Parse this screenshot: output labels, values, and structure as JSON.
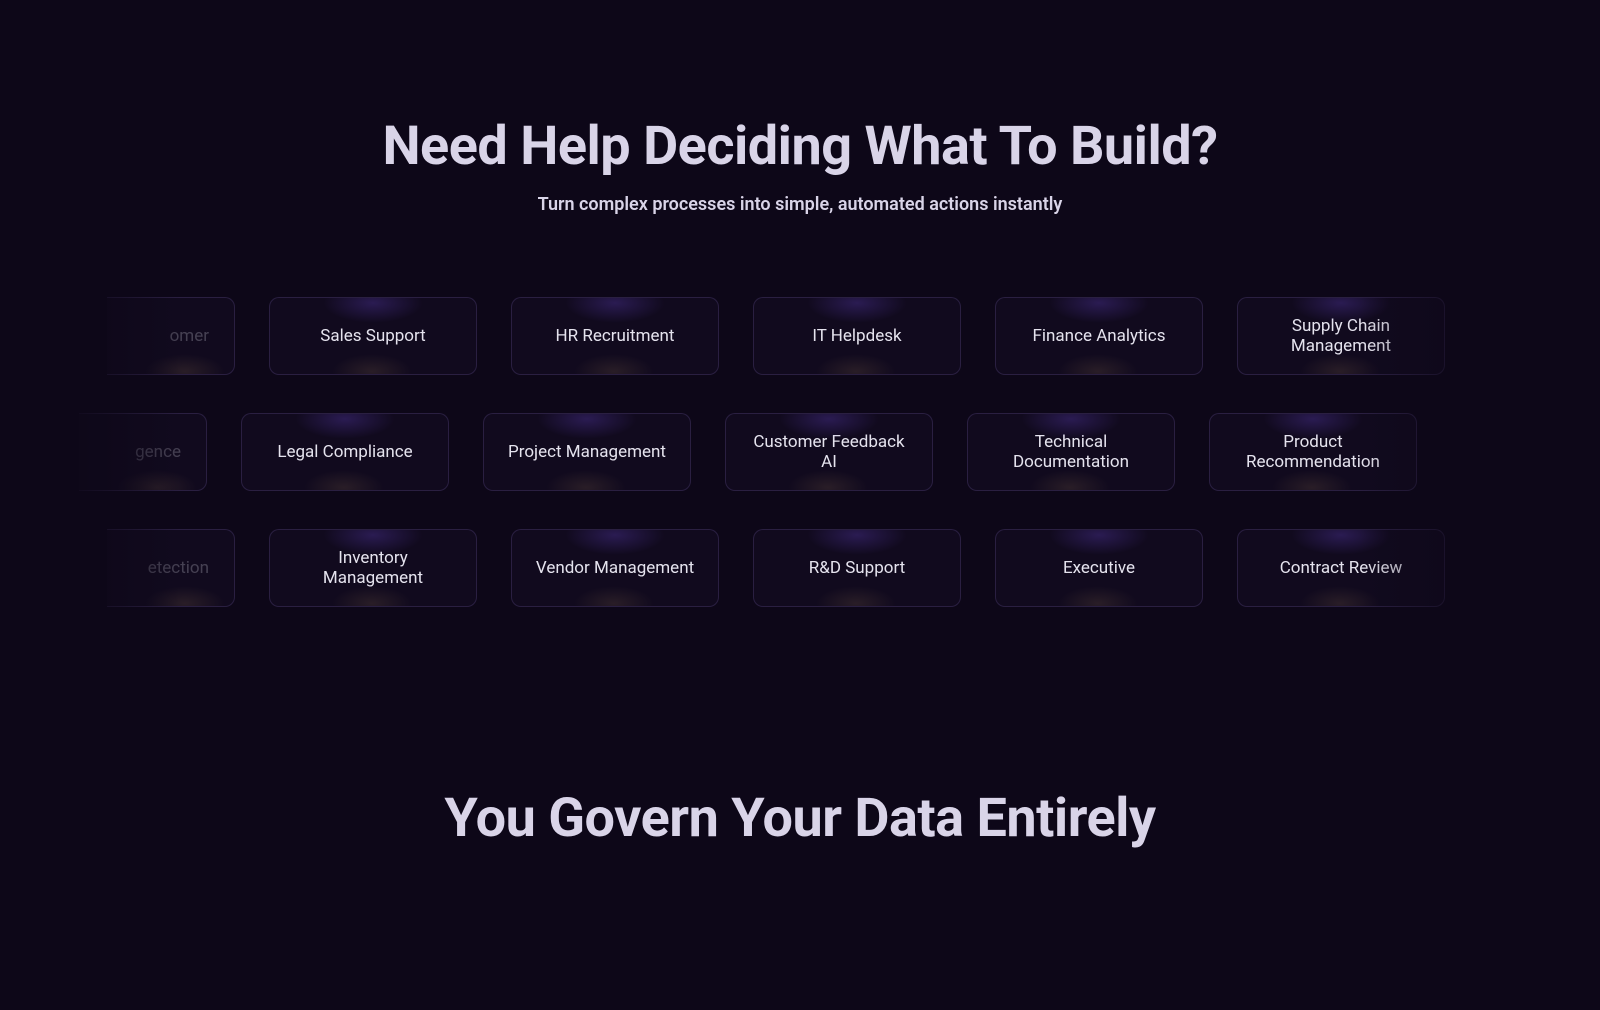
{
  "hero": {
    "title": "Need Help Deciding What To Build?",
    "subtitle": "Turn complex processes into simple, automated actions instantly"
  },
  "rows": {
    "row1": {
      "partial_left": "omer",
      "cards": [
        "Sales Support",
        "HR Recruitment",
        "IT Helpdesk",
        "Finance Analytics",
        "Supply Chain Management"
      ]
    },
    "row2": {
      "partial_left": "gence",
      "cards": [
        "Legal Compliance",
        "Project Management",
        "Customer Feedback AI",
        "Technical Documentation",
        "Product Recommendation"
      ]
    },
    "row3": {
      "partial_left": "etection",
      "cards": [
        "Inventory Management",
        "Vendor Management",
        "R&D Support",
        "Executive",
        "Contract Review"
      ]
    }
  },
  "bottom": {
    "title": "You Govern Your Data Entirely"
  }
}
